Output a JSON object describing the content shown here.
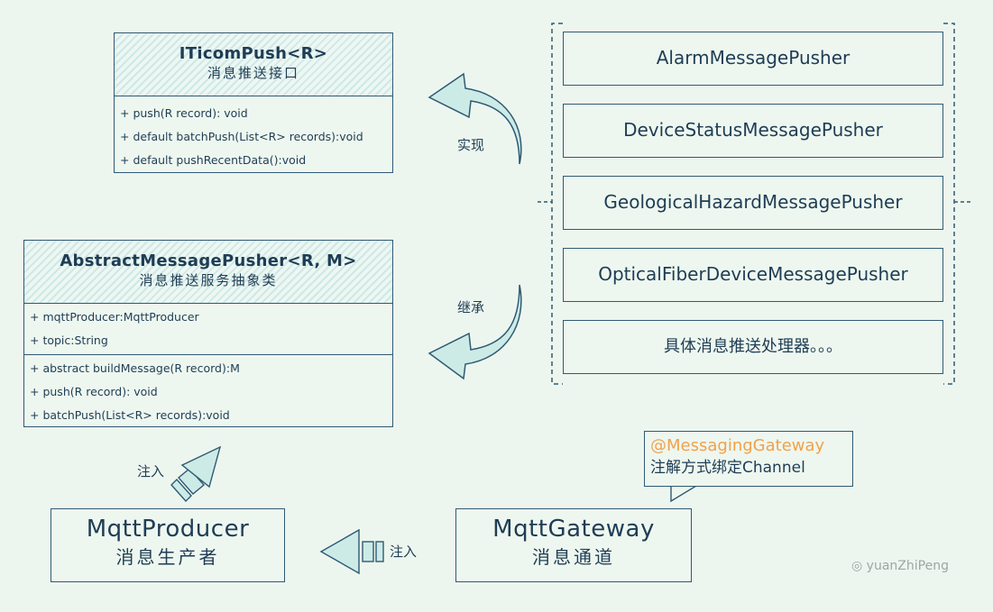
{
  "interface": {
    "name": "ITicomPush<R>",
    "subtitle": "消息推送接口",
    "methods": [
      "+ push(R record): void",
      "+ default batchPush(List<R> records):void",
      "+ default pushRecentData():void"
    ]
  },
  "abstract": {
    "name": "AbstractMessagePusher<R, M>",
    "subtitle": "消息推送服务抽象类",
    "fields": [
      "+ mqttProducer:MqttProducer",
      "+ topic:String"
    ],
    "methods": [
      "+ abstract buildMessage(R record):M",
      "+ push(R record): void",
      "+ batchPush(List<R> records):void"
    ]
  },
  "implementations": [
    "AlarmMessagePusher",
    "DeviceStatusMessagePusher",
    "GeologicalHazardMessagePusher",
    "OpticalFiberDeviceMessagePusher",
    "具体消息推送处理器。。。"
  ],
  "arrows": {
    "implements": "实现",
    "extends": "继承",
    "inject_top": "注入",
    "inject_bottom": "注入"
  },
  "producer": {
    "name": "MqttProducer",
    "subtitle": "消息生产者"
  },
  "gateway": {
    "name": "MqttGateway",
    "subtitle": "消息通道"
  },
  "callout": {
    "annotation": "@MessagingGateway",
    "text": "注解方式绑定Channel"
  },
  "watermark": "yuanZhiPeng",
  "colors": {
    "line": "#2f5a75",
    "background": "#edf6ee",
    "annotation": "#f2a14a",
    "hatch": "#cfe9e4"
  }
}
